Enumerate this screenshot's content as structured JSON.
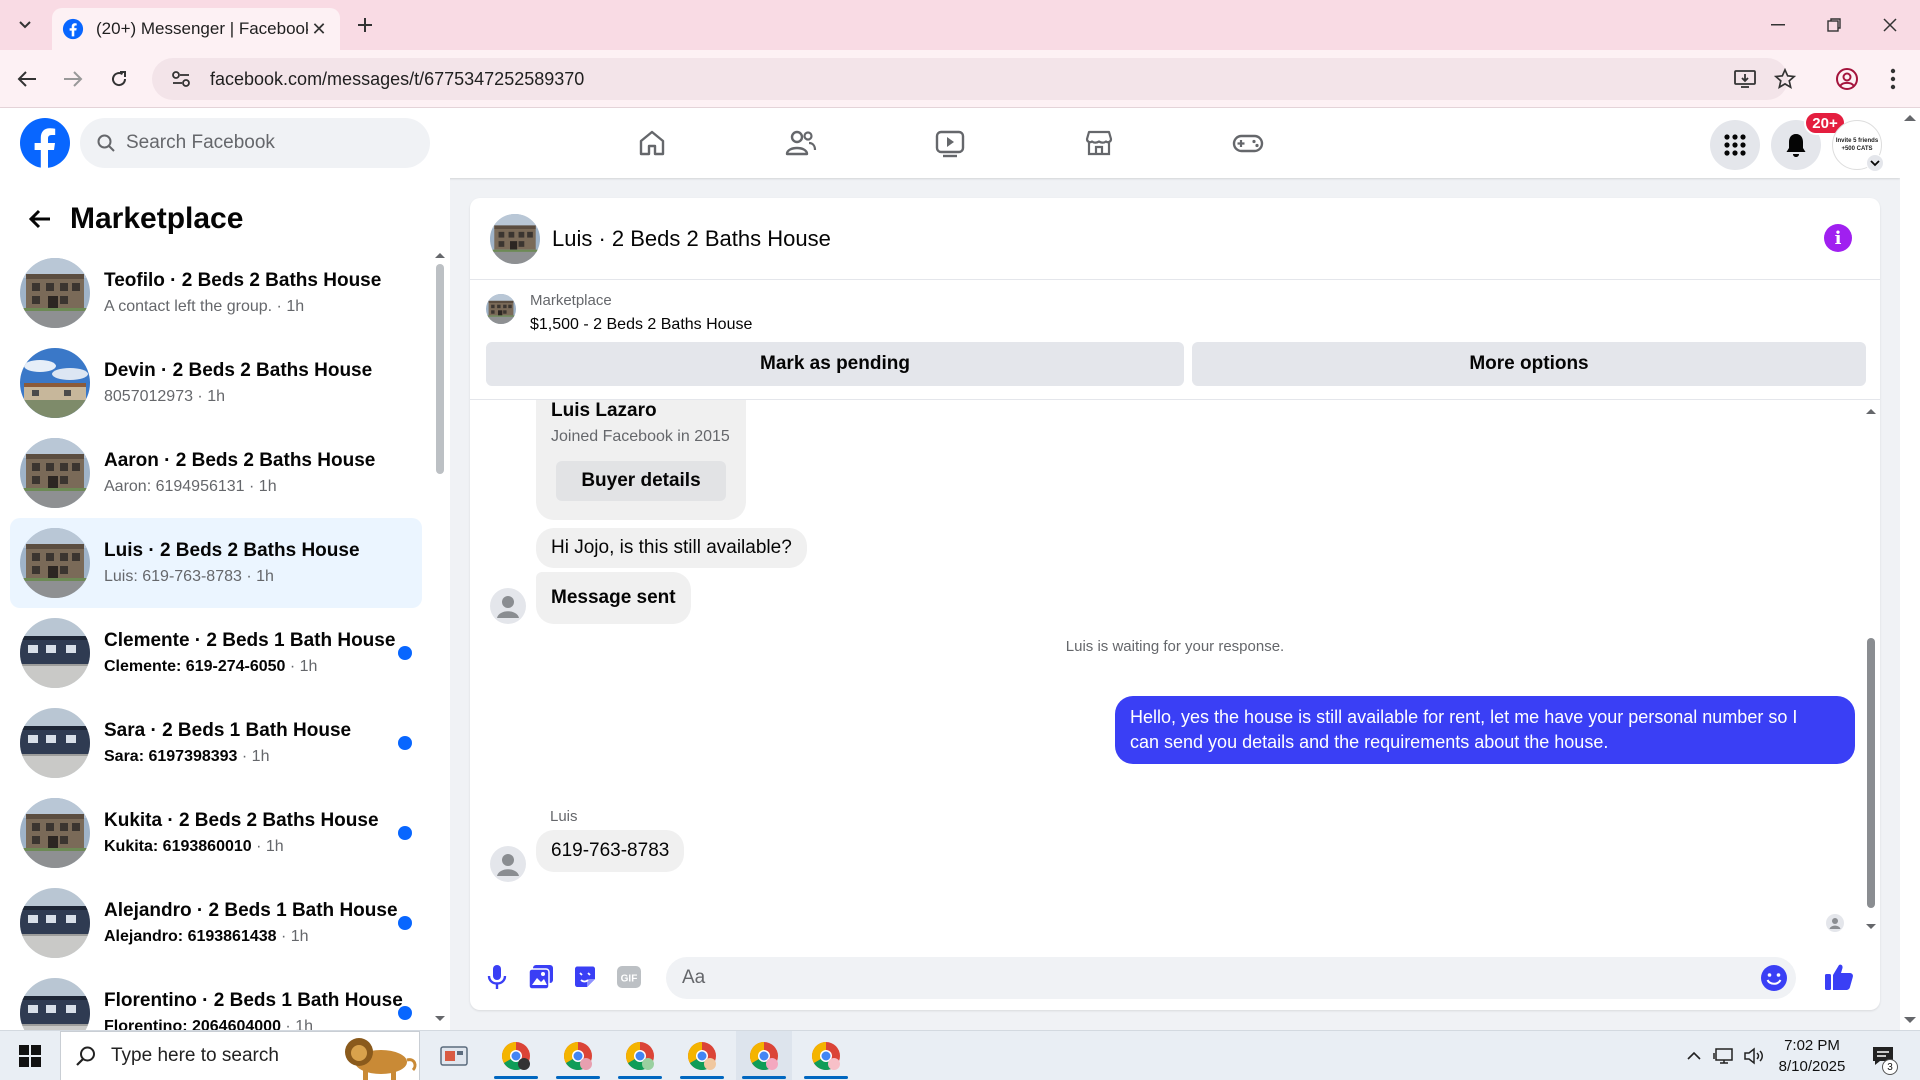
{
  "browser": {
    "tab_title": "(20+) Messenger | Facebook",
    "url": "facebook.com/messages/t/6775347252589370"
  },
  "fb": {
    "search_placeholder": "Search Facebook",
    "notification_badge": "20+",
    "profile_text_1": "Invite 5 friends",
    "profile_text_2": "+500 CATS"
  },
  "sidebar": {
    "title": "Marketplace",
    "conversations": [
      {
        "name": "Teofilo · 2 Beds 2 Baths House",
        "preview": "A contact left the group.",
        "time": " · 1h",
        "unread": false,
        "active": false,
        "thumb": "building"
      },
      {
        "name": "Devin · 2 Beds 2 Baths House",
        "preview": "8057012973",
        "time": " · 1h",
        "unread": false,
        "active": false,
        "thumb": "sky"
      },
      {
        "name": "Aaron · 2 Beds 2 Baths House",
        "preview": "Aaron: 6194956131",
        "time": " · 1h",
        "unread": false,
        "active": false,
        "thumb": "building"
      },
      {
        "name": "Luis · 2 Beds 2 Baths House",
        "preview": "Luis: 619-763-8783",
        "time": " · 1h",
        "unread": false,
        "active": true,
        "thumb": "building"
      },
      {
        "name": "Clemente · 2 Beds 1 Bath House",
        "preview": "Clemente: 619-274-6050",
        "time": " · 1h",
        "unread": true,
        "active": false,
        "thumb": "flat"
      },
      {
        "name": "Sara · 2 Beds 1 Bath House",
        "preview": "Sara: 6197398393",
        "time": " · 1h",
        "unread": true,
        "active": false,
        "thumb": "flat"
      },
      {
        "name": "Kukita · 2 Beds 2 Baths House",
        "preview": "Kukita: 6193860010",
        "time": " · 1h",
        "unread": true,
        "active": false,
        "thumb": "building"
      },
      {
        "name": "Alejandro · 2 Beds 1 Bath House",
        "preview": "Alejandro: 6193861438",
        "time": " · 1h",
        "unread": true,
        "active": false,
        "thumb": "flat"
      },
      {
        "name": "Florentino · 2 Beds 1 Bath House",
        "preview": "Florentino: 2064604000",
        "time": " · 1h",
        "unread": true,
        "active": false,
        "thumb": "flat"
      }
    ]
  },
  "chat": {
    "title": "Luis · 2 Beds 2 Baths House",
    "listing_label": "Marketplace",
    "listing_price": "$1,500 - 2 Beds 2 Baths House",
    "mark_pending": "Mark as pending",
    "more_options": "More options",
    "buyer_name": "Luis Lazaro",
    "buyer_joined": "Joined Facebook in 2015",
    "buyer_details": "Buyer details",
    "msg_1": "Hi Jojo, is this still available?",
    "msg_2": "Message sent",
    "waiting": "Luis is waiting for your response.",
    "reply_line_1": "Hello, yes the house is still available for rent, let me have your personal number so I",
    "reply_line_2": "can send you details and the requirements about the house.",
    "sender": "Luis",
    "msg_3": "619-763-8783",
    "composer_placeholder": "Aa",
    "accent": "#3a3ff5"
  },
  "taskbar": {
    "search_placeholder": "Type here to search",
    "time": "7:02 PM",
    "date": "8/10/2025",
    "notifications": "3"
  }
}
